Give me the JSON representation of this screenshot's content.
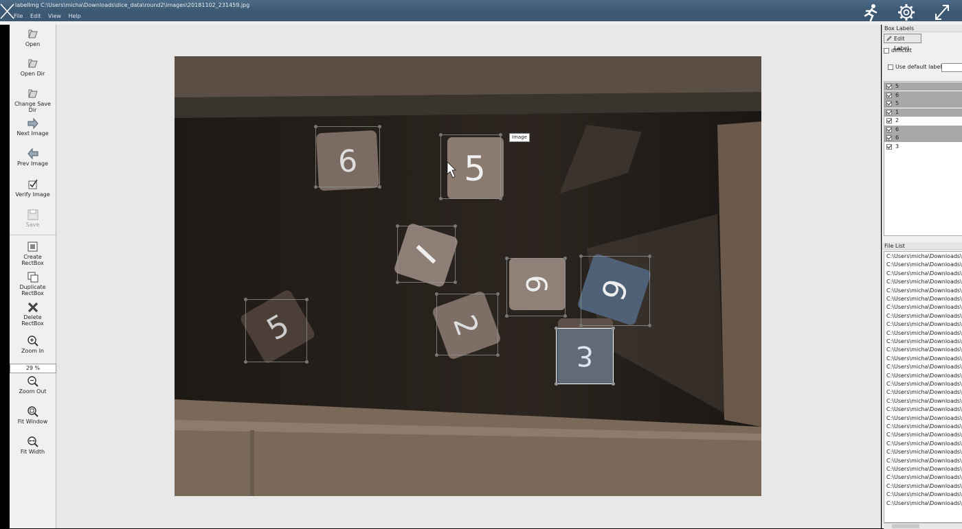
{
  "window": {
    "title": "labelImg C:\\Users\\micha\\Downloads\\dice_data\\round2\\images\\20181102_231459.jpg"
  },
  "menu": [
    "File",
    "Edit",
    "View",
    "Help"
  ],
  "overlay_icons": [
    "close-icon",
    "running-person-icon",
    "gear-icon",
    "expand-icon"
  ],
  "toolbar": {
    "open": "Open",
    "open_dir": "Open Dir",
    "change_save_dir": "Change Save Dir",
    "next_image": "Next Image",
    "prev_image": "Prev Image",
    "verify_image": "Verify Image",
    "save": "Save",
    "create_rectbox": "Create\nRectBox",
    "duplicate_rectbox": "Duplicate\nRectBox",
    "delete_rectbox": "Delete\nRectBox",
    "zoom_in": "Zoom In",
    "zoom_value": "29 %",
    "zoom_out": "Zoom Out",
    "fit_window": "Fit Window",
    "fit_width": "Fit Width"
  },
  "canvas": {
    "tooltip": "Image",
    "selected_box_label": "3"
  },
  "right_panel": {
    "box_labels_title": "Box Labels",
    "edit_label": "Edit Label",
    "difficult": "difficult",
    "use_default_label": "Use default label",
    "default_label_value": "",
    "labels": [
      {
        "text": "5",
        "checked": true,
        "highlight": true
      },
      {
        "text": "6",
        "checked": true,
        "highlight": true
      },
      {
        "text": "5",
        "checked": true,
        "highlight": true
      },
      {
        "text": "1",
        "checked": true,
        "highlight": true
      },
      {
        "text": "2",
        "checked": true,
        "highlight": false
      },
      {
        "text": "6",
        "checked": true,
        "highlight": true
      },
      {
        "text": "6",
        "checked": true,
        "highlight": true
      },
      {
        "text": "3",
        "checked": true,
        "highlight": false
      }
    ],
    "file_list_title": "File List",
    "file_entry": "C:\\Users\\micha\\Downloads\\d",
    "file_entry_count": 30
  },
  "colors": {
    "titlebar": "#3c5873",
    "selected_box": "#6482a0",
    "highlight_row": "#a8a8a8"
  }
}
